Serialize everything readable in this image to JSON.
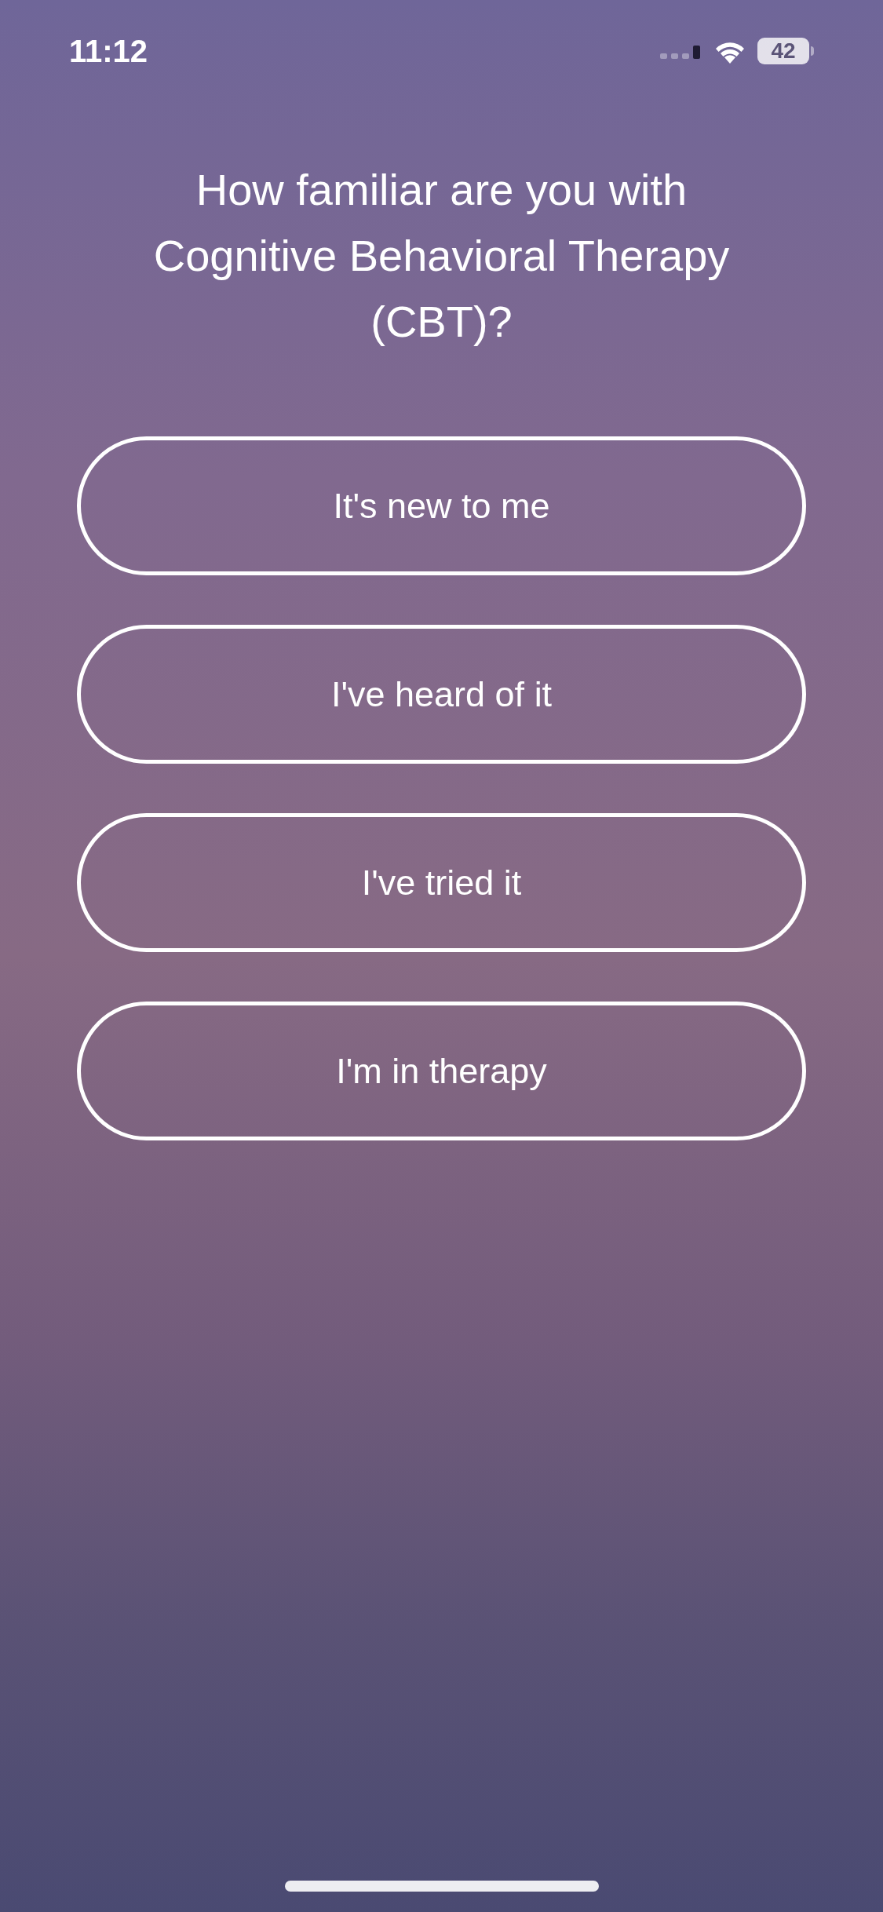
{
  "status_bar": {
    "time": "11:12",
    "battery": "42"
  },
  "question": "How familiar are you with Cognitive Behavioral Therapy (CBT)?",
  "options": [
    {
      "label": "It's new to me",
      "selected": false
    },
    {
      "label": "I've heard of it",
      "selected": false
    },
    {
      "label": "I've tried it",
      "selected": false
    },
    {
      "label": "I'm in therapy",
      "selected": false
    }
  ]
}
